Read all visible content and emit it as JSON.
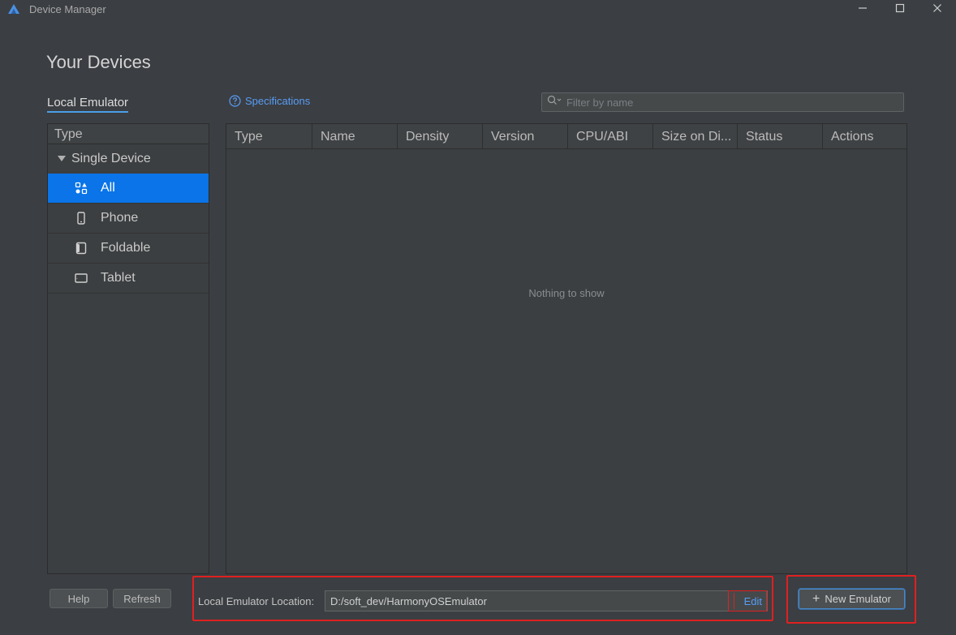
{
  "window": {
    "title": "Device Manager",
    "icons": {
      "app": "harmony-logo-icon",
      "minimize": "minimize-icon",
      "maximize": "maximize-icon",
      "close": "close-icon"
    }
  },
  "page": {
    "title": "Your Devices",
    "tab_label": "Local Emulator",
    "spec_link": "Specifications",
    "filter_placeholder": "Filter by name"
  },
  "sidebar": {
    "header": "Type",
    "group": "Single Device",
    "items": [
      {
        "label": "All",
        "icon": "grid-shapes-icon",
        "selected": true
      },
      {
        "label": "Phone",
        "icon": "phone-icon",
        "selected": false
      },
      {
        "label": "Foldable",
        "icon": "foldable-icon",
        "selected": false
      },
      {
        "label": "Tablet",
        "icon": "tablet-icon",
        "selected": false
      }
    ]
  },
  "table": {
    "columns": [
      "Type",
      "Name",
      "Density",
      "Version",
      "CPU/ABI",
      "Size on Di...",
      "Status",
      "Actions"
    ],
    "empty_message": "Nothing to show"
  },
  "footer": {
    "help": "Help",
    "refresh": "Refresh",
    "location_label": "Local Emulator Location:",
    "location_value": "D:/soft_dev/HarmonyOSEmulator",
    "edit": "Edit",
    "new_emulator": "New Emulator"
  },
  "colors": {
    "background": "#3b3e42",
    "accent_blue": "#589df6",
    "selection": "#0a74e8",
    "highlight_red": "#e02020"
  }
}
